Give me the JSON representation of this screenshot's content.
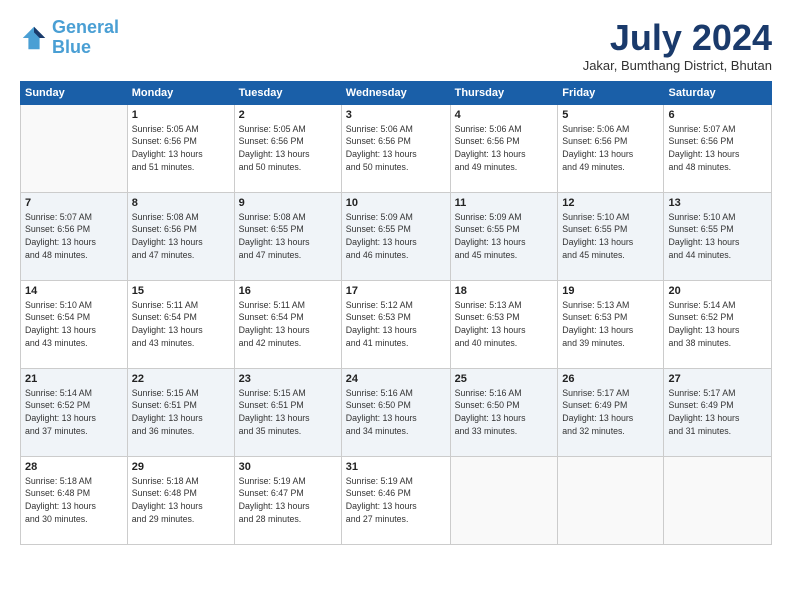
{
  "header": {
    "logo_line1": "General",
    "logo_line2": "Blue",
    "month": "July 2024",
    "location": "Jakar, Bumthang District, Bhutan"
  },
  "weekdays": [
    "Sunday",
    "Monday",
    "Tuesday",
    "Wednesday",
    "Thursday",
    "Friday",
    "Saturday"
  ],
  "weeks": [
    [
      {
        "day": "",
        "info": ""
      },
      {
        "day": "1",
        "info": "Sunrise: 5:05 AM\nSunset: 6:56 PM\nDaylight: 13 hours\nand 51 minutes."
      },
      {
        "day": "2",
        "info": "Sunrise: 5:05 AM\nSunset: 6:56 PM\nDaylight: 13 hours\nand 50 minutes."
      },
      {
        "day": "3",
        "info": "Sunrise: 5:06 AM\nSunset: 6:56 PM\nDaylight: 13 hours\nand 50 minutes."
      },
      {
        "day": "4",
        "info": "Sunrise: 5:06 AM\nSunset: 6:56 PM\nDaylight: 13 hours\nand 49 minutes."
      },
      {
        "day": "5",
        "info": "Sunrise: 5:06 AM\nSunset: 6:56 PM\nDaylight: 13 hours\nand 49 minutes."
      },
      {
        "day": "6",
        "info": "Sunrise: 5:07 AM\nSunset: 6:56 PM\nDaylight: 13 hours\nand 48 minutes."
      }
    ],
    [
      {
        "day": "7",
        "info": "Sunrise: 5:07 AM\nSunset: 6:56 PM\nDaylight: 13 hours\nand 48 minutes."
      },
      {
        "day": "8",
        "info": "Sunrise: 5:08 AM\nSunset: 6:56 PM\nDaylight: 13 hours\nand 47 minutes."
      },
      {
        "day": "9",
        "info": "Sunrise: 5:08 AM\nSunset: 6:55 PM\nDaylight: 13 hours\nand 47 minutes."
      },
      {
        "day": "10",
        "info": "Sunrise: 5:09 AM\nSunset: 6:55 PM\nDaylight: 13 hours\nand 46 minutes."
      },
      {
        "day": "11",
        "info": "Sunrise: 5:09 AM\nSunset: 6:55 PM\nDaylight: 13 hours\nand 45 minutes."
      },
      {
        "day": "12",
        "info": "Sunrise: 5:10 AM\nSunset: 6:55 PM\nDaylight: 13 hours\nand 45 minutes."
      },
      {
        "day": "13",
        "info": "Sunrise: 5:10 AM\nSunset: 6:55 PM\nDaylight: 13 hours\nand 44 minutes."
      }
    ],
    [
      {
        "day": "14",
        "info": "Sunrise: 5:10 AM\nSunset: 6:54 PM\nDaylight: 13 hours\nand 43 minutes."
      },
      {
        "day": "15",
        "info": "Sunrise: 5:11 AM\nSunset: 6:54 PM\nDaylight: 13 hours\nand 43 minutes."
      },
      {
        "day": "16",
        "info": "Sunrise: 5:11 AM\nSunset: 6:54 PM\nDaylight: 13 hours\nand 42 minutes."
      },
      {
        "day": "17",
        "info": "Sunrise: 5:12 AM\nSunset: 6:53 PM\nDaylight: 13 hours\nand 41 minutes."
      },
      {
        "day": "18",
        "info": "Sunrise: 5:13 AM\nSunset: 6:53 PM\nDaylight: 13 hours\nand 40 minutes."
      },
      {
        "day": "19",
        "info": "Sunrise: 5:13 AM\nSunset: 6:53 PM\nDaylight: 13 hours\nand 39 minutes."
      },
      {
        "day": "20",
        "info": "Sunrise: 5:14 AM\nSunset: 6:52 PM\nDaylight: 13 hours\nand 38 minutes."
      }
    ],
    [
      {
        "day": "21",
        "info": "Sunrise: 5:14 AM\nSunset: 6:52 PM\nDaylight: 13 hours\nand 37 minutes."
      },
      {
        "day": "22",
        "info": "Sunrise: 5:15 AM\nSunset: 6:51 PM\nDaylight: 13 hours\nand 36 minutes."
      },
      {
        "day": "23",
        "info": "Sunrise: 5:15 AM\nSunset: 6:51 PM\nDaylight: 13 hours\nand 35 minutes."
      },
      {
        "day": "24",
        "info": "Sunrise: 5:16 AM\nSunset: 6:50 PM\nDaylight: 13 hours\nand 34 minutes."
      },
      {
        "day": "25",
        "info": "Sunrise: 5:16 AM\nSunset: 6:50 PM\nDaylight: 13 hours\nand 33 minutes."
      },
      {
        "day": "26",
        "info": "Sunrise: 5:17 AM\nSunset: 6:49 PM\nDaylight: 13 hours\nand 32 minutes."
      },
      {
        "day": "27",
        "info": "Sunrise: 5:17 AM\nSunset: 6:49 PM\nDaylight: 13 hours\nand 31 minutes."
      }
    ],
    [
      {
        "day": "28",
        "info": "Sunrise: 5:18 AM\nSunset: 6:48 PM\nDaylight: 13 hours\nand 30 minutes."
      },
      {
        "day": "29",
        "info": "Sunrise: 5:18 AM\nSunset: 6:48 PM\nDaylight: 13 hours\nand 29 minutes."
      },
      {
        "day": "30",
        "info": "Sunrise: 5:19 AM\nSunset: 6:47 PM\nDaylight: 13 hours\nand 28 minutes."
      },
      {
        "day": "31",
        "info": "Sunrise: 5:19 AM\nSunset: 6:46 PM\nDaylight: 13 hours\nand 27 minutes."
      },
      {
        "day": "",
        "info": ""
      },
      {
        "day": "",
        "info": ""
      },
      {
        "day": "",
        "info": ""
      }
    ]
  ]
}
